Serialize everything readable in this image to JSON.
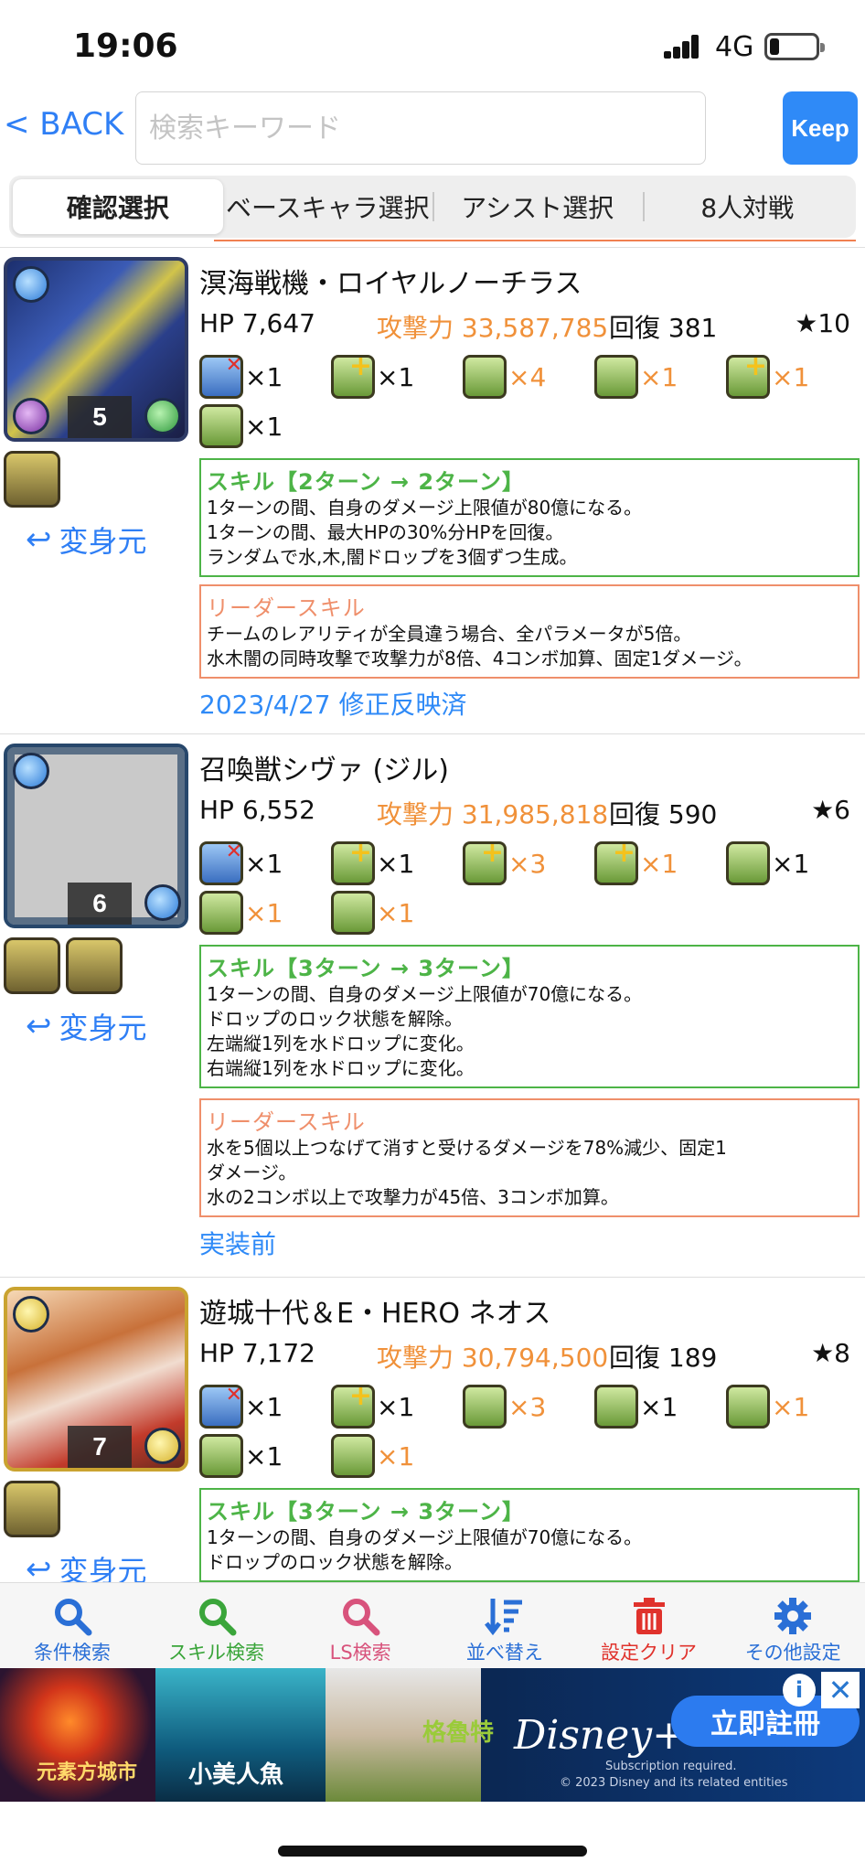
{
  "status_bar": {
    "time": "19:06",
    "network": "4G"
  },
  "topbar": {
    "back_label": "< BACK",
    "search_placeholder": "検索キーワード",
    "keep_label": "Keep"
  },
  "tabs": [
    {
      "label": "確認選択",
      "active": true
    },
    {
      "label": "ベースキャラ選択",
      "active": false
    },
    {
      "label": "アシスト選択",
      "active": false
    },
    {
      "label": "8人対戦",
      "active": false
    }
  ],
  "henshin_label": "変身元",
  "monsters": [
    {
      "number": "5",
      "name": "溟海戦機・ロイヤルノーチラス",
      "hp": "HP 7,647",
      "atk": "攻撃力 33,587,785",
      "rcv": "回復 381",
      "star": "★10",
      "awakenings": [
        [
          {
            "icon": "skill-bind-resist-icon",
            "count": "×1",
            "orange": false
          },
          {
            "icon": "finger-plus-icon",
            "count": "×1",
            "orange": false
          },
          {
            "icon": "ten-combo-icon",
            "count": "×4",
            "orange": true
          },
          {
            "icon": "drop-plus-icon",
            "count": "×1",
            "orange": true
          },
          {
            "icon": "combo-plus-icon",
            "count": "×1",
            "orange": true
          }
        ],
        [
          {
            "icon": "damage-void-icon",
            "count": "×1",
            "orange": false
          }
        ]
      ],
      "skill": {
        "head": "スキル【2ターン → 2ターン】",
        "lines": [
          "1ターンの間、自身のダメージ上限値が80億になる。",
          "1ターンの間、最大HPの30%分HPを回復。",
          "ランダムで水,木,闇ドロップを3個ずつ生成。"
        ]
      },
      "leader": {
        "head": "リーダースキル",
        "lines": [
          "チームのレアリティが全員違う場合、全パラメータが5倍。",
          "水木闇の同時攻撃で攻撃力が8倍、4コンボ加算、固定1ダメージ。"
        ]
      },
      "note": "2023/4/27 修正反映済"
    },
    {
      "number": "6",
      "name": "召喚獣シヴァ (ジル)",
      "hp": "HP 6,552",
      "atk": "攻撃力 31,985,818",
      "rcv": "回復 590",
      "star": "★6",
      "awakenings": [
        [
          {
            "icon": "skill-bind-resist-icon",
            "count": "×1",
            "orange": false
          },
          {
            "icon": "finger-plus-icon",
            "count": "×1",
            "orange": false
          },
          {
            "icon": "seven-combo-icon",
            "count": "×3",
            "orange": true
          },
          {
            "icon": "combo-plus-icon",
            "count": "×1",
            "orange": true
          },
          {
            "icon": "damage-void-icon",
            "count": "×1",
            "orange": false
          }
        ],
        [
          {
            "icon": "super-damage-void-icon",
            "count": "×1",
            "orange": true
          },
          {
            "icon": "voice-icon",
            "count": "×1",
            "orange": true
          }
        ]
      ],
      "skill": {
        "head": "スキル【3ターン → 3ターン】",
        "lines": [
          "1ターンの間、自身のダメージ上限値が70億になる。",
          "ドロップのロック状態を解除。",
          "左端縦1列を水ドロップに変化。",
          "右端縦1列を水ドロップに変化。"
        ]
      },
      "leader": {
        "head": "リーダースキル",
        "lines": [
          "水を5個以上つなげて消すと受けるダメージを78%減少、固定1",
          "ダメージ。",
          "水の2コンボ以上で攻撃力が45倍、3コンボ加算。"
        ]
      },
      "note": "実装前"
    },
    {
      "number": "7",
      "name": "遊城十代＆E・HERO ネオス",
      "hp": "HP 7,172",
      "atk": "攻撃力 30,794,500",
      "rcv": "回復 189",
      "star": "★8",
      "awakenings": [
        [
          {
            "icon": "skill-bind-resist-icon",
            "count": "×1",
            "orange": false
          },
          {
            "icon": "finger-plus-icon",
            "count": "×1",
            "orange": false
          },
          {
            "icon": "ten-combo-icon",
            "count": "×3",
            "orange": true
          },
          {
            "icon": "l-shape-icon",
            "count": "×1",
            "orange": false
          },
          {
            "icon": "drop-plus-icon",
            "count": "×1",
            "orange": true
          }
        ],
        [
          {
            "icon": "damage-void-icon",
            "count": "×1",
            "orange": false
          },
          {
            "icon": "super-damage-void-icon",
            "count": "×1",
            "orange": true
          }
        ]
      ],
      "skill": {
        "head": "スキル【3ターン → 3ターン】",
        "lines": [
          "1ターンの間、自身のダメージ上限値が70億になる。",
          "ドロップのロック状態を解除。"
        ]
      }
    }
  ],
  "toolbar": [
    {
      "label": "条件検索",
      "color": "#2a6fd6",
      "icon": "search-icon"
    },
    {
      "label": "スキル検索",
      "color": "#3aa53a",
      "icon": "search-icon"
    },
    {
      "label": "LS検索",
      "color": "#d8537c",
      "icon": "search-icon"
    },
    {
      "label": "並べ替え",
      "color": "#2a6fd6",
      "icon": "sort-icon"
    },
    {
      "label": "設定クリア",
      "color": "#e0322c",
      "icon": "trash-icon"
    },
    {
      "label": "その他設定",
      "color": "#2a6fd6",
      "icon": "gear-icon"
    }
  ],
  "ad": {
    "text1": "元素方城市",
    "text2": "小美人魚",
    "text3": "格魯特",
    "brand": "Disney+",
    "cta": "立即註冊",
    "fine1": "Subscription required.",
    "fine2": "© 2023 Disney and its related entities"
  },
  "colors": {
    "link": "#2f7ff5",
    "attack": "#f0913a",
    "skill_border": "#4db447",
    "leader_border": "#ef8f6b"
  }
}
